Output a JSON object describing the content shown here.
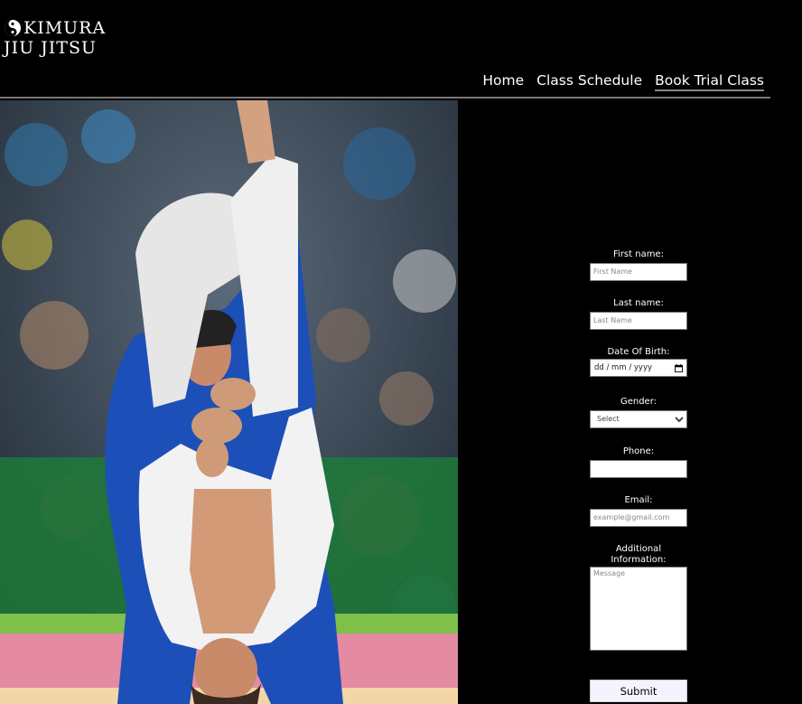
{
  "brand": {
    "line1": "KIMURA",
    "line2": "JIU JITSU",
    "icon": "yin-yang-icon"
  },
  "nav": {
    "items": [
      "Home",
      "Class Schedule",
      "Book Trial Class"
    ],
    "active": "Book Trial Class"
  },
  "photo": {
    "icon": "judo-throw-photo"
  },
  "form": {
    "first_name": {
      "label": "First name:",
      "placeholder": "First Name"
    },
    "last_name": {
      "label": "Last name:",
      "placeholder": "Last Name"
    },
    "dob": {
      "label": "Date Of Birth:",
      "value": "dd / mm / yyyy",
      "icon": "calendar-icon"
    },
    "gender": {
      "label": "Gender:",
      "selected": "Select"
    },
    "phone": {
      "label": "Phone:"
    },
    "email": {
      "label": "Email:",
      "placeholder": "example@gmail.com"
    },
    "info": {
      "label_line1": "Additional",
      "label_line2": "Information:",
      "placeholder": "Message"
    },
    "submit_label": "Submit"
  },
  "colors": {
    "background": "#000000",
    "text": "#ffffff",
    "divider": "#777777",
    "judogi_blue": "#1d4fb8",
    "mat_green": "#4fa84a",
    "mat_pink": "#e58aa3"
  }
}
